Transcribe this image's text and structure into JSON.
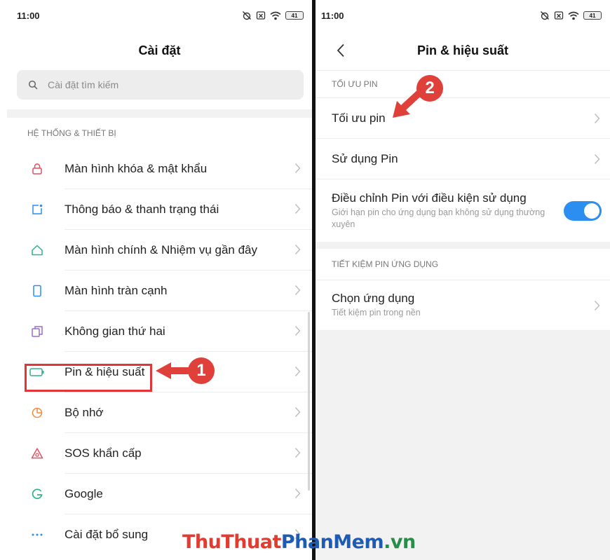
{
  "left": {
    "status": {
      "time": "11:00",
      "battery": "41"
    },
    "title": "Cài đặt",
    "search": {
      "placeholder": "Cài đặt tìm kiếm"
    },
    "section_header": "HỆ THỐNG & THIẾT BỊ",
    "items": [
      {
        "label": "Màn hình khóa & mật khẩu",
        "icon": "lock-icon",
        "color": "#e05060"
      },
      {
        "label": "Thông báo & thanh trạng thái",
        "icon": "notification-icon",
        "color": "#2b8ef0"
      },
      {
        "label": "Màn hình chính & Nhiệm vụ gần đây",
        "icon": "home-icon",
        "color": "#2fb38a"
      },
      {
        "label": "Màn hình tràn cạnh",
        "icon": "fullscreen-icon",
        "color": "#2b8ef0"
      },
      {
        "label": "Không gian thứ hai",
        "icon": "second-space-icon",
        "color": "#9a6ad6"
      },
      {
        "label": "Pin & hiệu suất",
        "icon": "battery-icon",
        "color": "#2fb38a"
      },
      {
        "label": "Bộ nhớ",
        "icon": "storage-icon",
        "color": "#f08a3c"
      },
      {
        "label": "SOS khẩn cấp",
        "icon": "sos-icon",
        "color": "#e05060"
      },
      {
        "label": "Google",
        "icon": "google-icon",
        "color": "#2fb38a"
      },
      {
        "label": "Cài đặt bổ sung",
        "icon": "more-icon",
        "color": "#2b8ef0"
      }
    ],
    "callout_number": "1"
  },
  "right": {
    "status": {
      "time": "11:00",
      "battery": "41"
    },
    "title": "Pin & hiệu suất",
    "section1_header": "TỐI ƯU PIN",
    "optimize_label": "Tối ưu pin",
    "usage_label": "Sử dụng Pin",
    "adjust": {
      "label": "Điều chỉnh Pin với điều kiện sử dụng",
      "sub": "Giới hạn pin cho ứng dụng bạn không sử dụng thường xuyên",
      "enabled": true
    },
    "section2_header": "TIẾT KIỆM PIN ỨNG DỤNG",
    "choose_app": {
      "label": "Chọn ứng dụng",
      "sub": "Tiết kiệm pin trong nền"
    },
    "callout_number": "2"
  },
  "watermark": {
    "part1": "ThuThuat",
    "part2": "PhanMem",
    "part3": ".vn"
  },
  "colors": {
    "accent_blue": "#2b8ef0",
    "callout_red": "#e0403a",
    "highlight_red": "#e23636"
  }
}
